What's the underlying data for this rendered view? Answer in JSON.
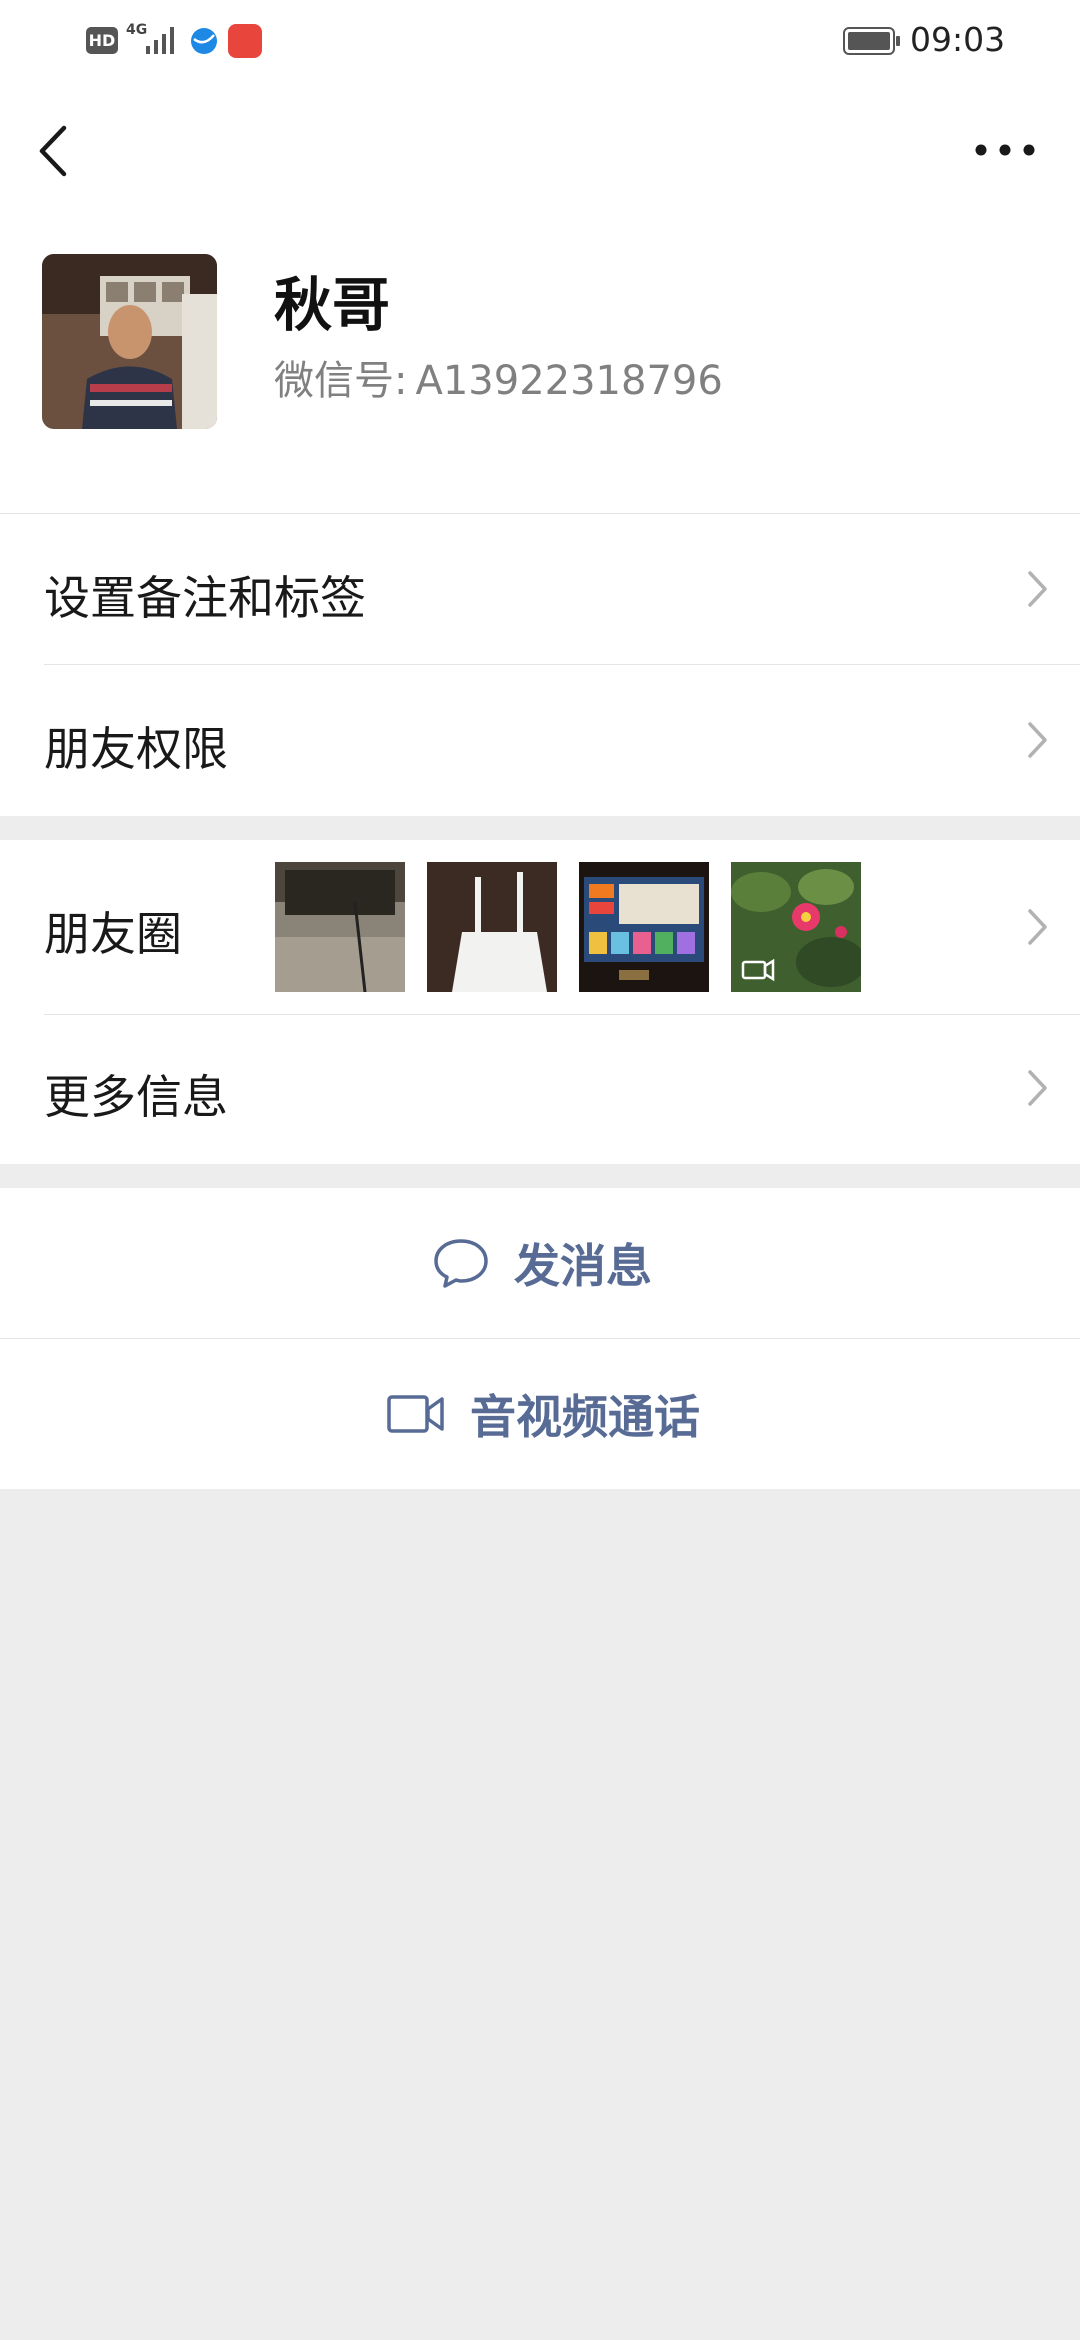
{
  "status_bar": {
    "hd_badge": "HD",
    "network": "4G",
    "time": "09:03",
    "icons": [
      "hd-icon",
      "signal-icon",
      "globe-icon",
      "app-store-icon",
      "battery-icon"
    ]
  },
  "nav": {
    "back_icon": "chevron-left-icon",
    "more_icon": "more-dots-icon"
  },
  "profile": {
    "name": "秋哥",
    "wechat_id_label": "微信号:",
    "wechat_id": "A13922318796"
  },
  "menu": {
    "remark_tags": "设置备注和标签",
    "permissions": "朋友权限",
    "moments": "朋友圈",
    "more_info": "更多信息"
  },
  "moments_thumbs": [
    {
      "name": "moments-thumb-1",
      "desc_icon": "photo"
    },
    {
      "name": "moments-thumb-2",
      "desc_icon": "photo"
    },
    {
      "name": "moments-thumb-3",
      "desc_icon": "photo"
    },
    {
      "name": "moments-thumb-4",
      "desc_icon": "video-icon"
    }
  ],
  "actions": {
    "send_message": "发消息",
    "video_call": "音视频通话"
  },
  "colors": {
    "link": "#576b95",
    "background": "#ededed",
    "text": "#191919",
    "secondary_text": "#808080"
  }
}
